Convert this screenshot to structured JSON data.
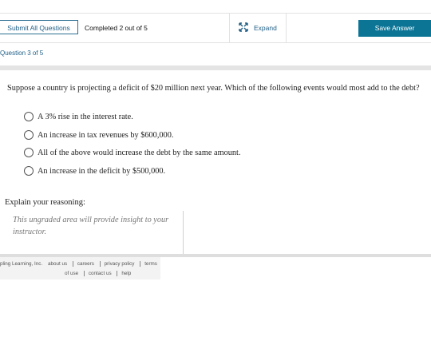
{
  "toolbar": {
    "submit_all": "Submit All Questions",
    "completed": "Completed 2 out of 5",
    "expand": "Expand",
    "save": "Save Answer"
  },
  "question": {
    "number_label": "Question 3 of 5",
    "prompt": "Suppose a country is projecting a deficit of $20 million next year. Which of the following events would most add to the debt?",
    "options": [
      "A 3% rise in the interest rate.",
      "An increase in tax revenues by $600,000.",
      "All of the above would increase the debt by the same amount.",
      "An increase in the deficit by $500,000."
    ]
  },
  "reasoning": {
    "label": "Explain your reasoning:",
    "placeholder": "This ungraded area will provide insight to your instructor."
  },
  "footer": {
    "company": "pling Learning, Inc.",
    "links": [
      "about us",
      "careers",
      "privacy policy",
      "terms",
      "of use",
      "contact us",
      "help"
    ]
  },
  "colors": {
    "accent": "#0c7596",
    "link": "#1f5f86"
  },
  "icons": {
    "expand": "expand-arrows-icon"
  }
}
